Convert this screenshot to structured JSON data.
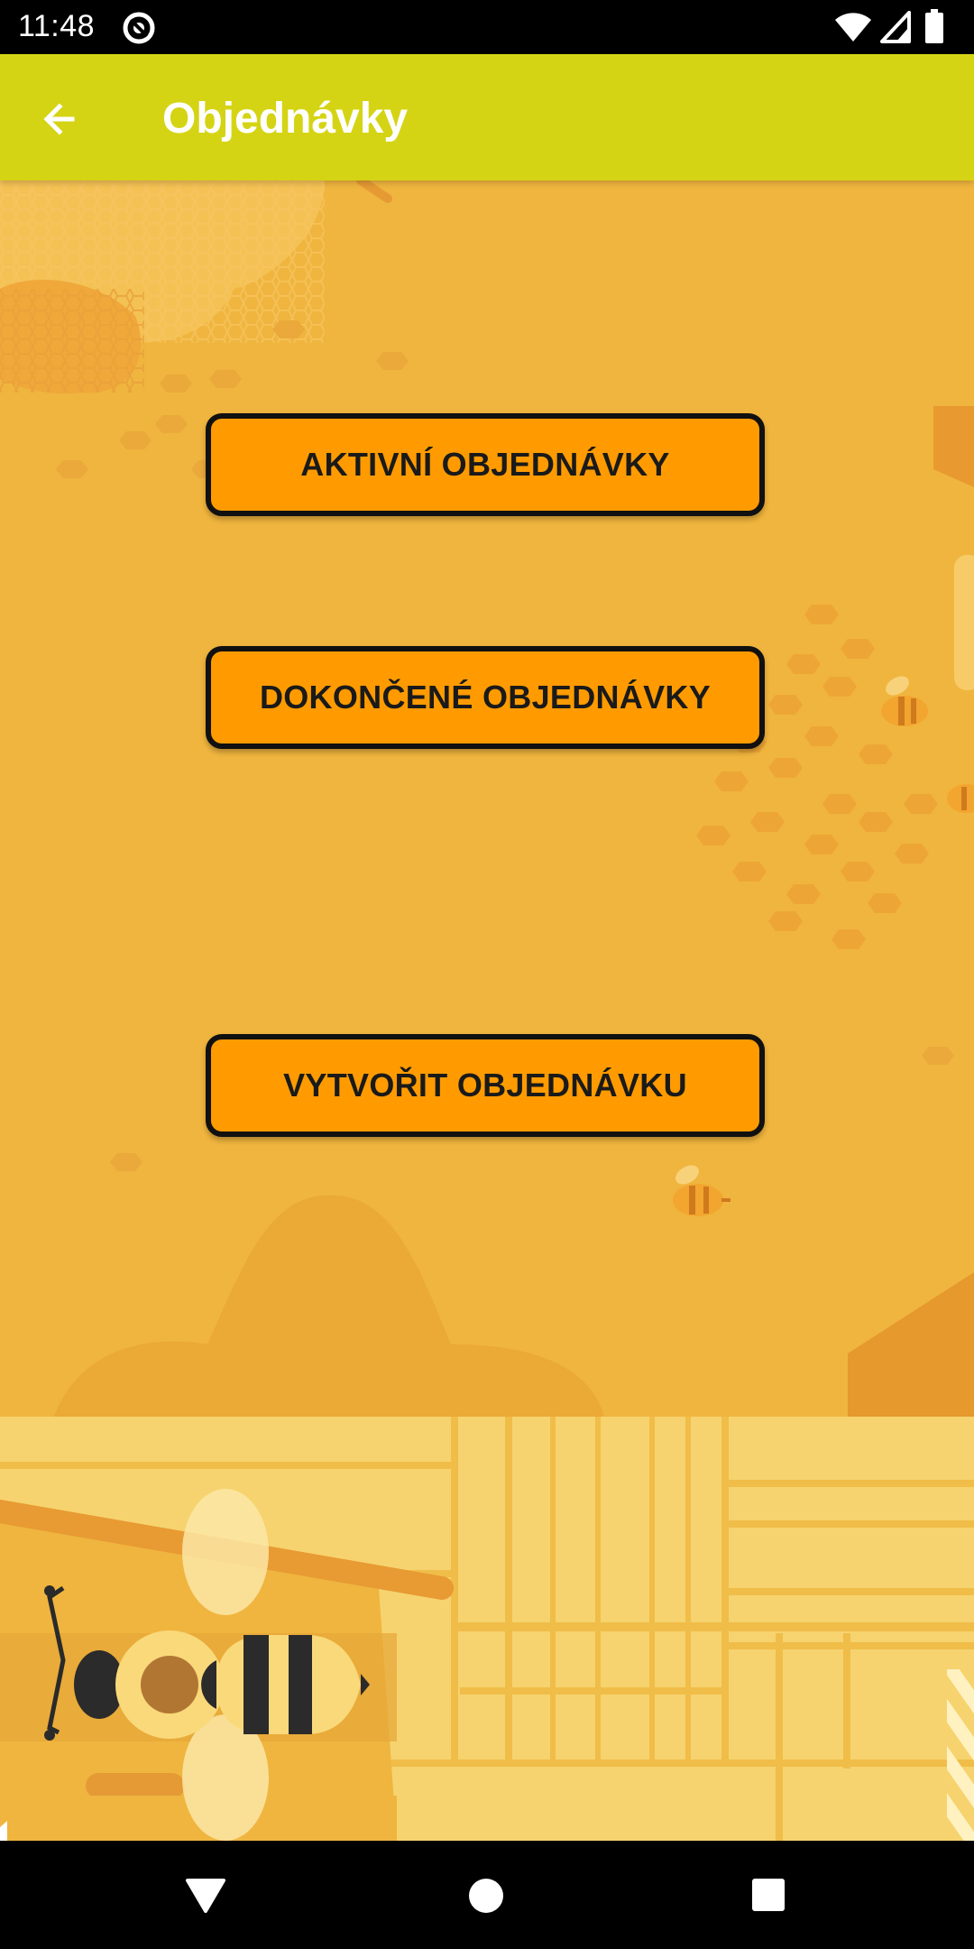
{
  "status_bar": {
    "time": "11:48"
  },
  "app_bar": {
    "title": "Objednávky"
  },
  "buttons": {
    "active_orders": "AKTIVNÍ OBJEDNÁVKY",
    "completed_orders": "DOKONČENÉ OBJEDNÁVKY",
    "create_order": "VYTVOŘIT OBJEDNÁVKU"
  },
  "colors": {
    "app_bar": "#d5d414",
    "background": "#f0b53e",
    "button_fill": "#ff9b00",
    "button_border": "#111111"
  },
  "icons": {
    "back": "arrow-left-icon",
    "status_app": "at-sign-icon",
    "wifi": "wifi-icon",
    "signal": "cell-signal-icon",
    "battery": "battery-icon",
    "nav_back": "triangle-back-icon",
    "nav_home": "circle-home-icon",
    "nav_recents": "square-recents-icon"
  }
}
